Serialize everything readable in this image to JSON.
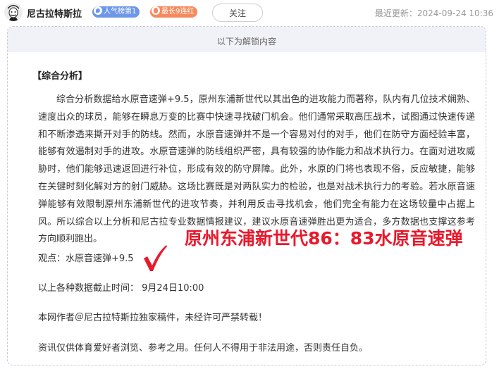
{
  "header": {
    "author_name": "尼古拉特斯拉",
    "badge_popularity": "人气榜第1",
    "badge_streak": "最长9连红",
    "follow_label": "关注",
    "update_label": "最近更新：",
    "update_time": "2024-09-24 10:36"
  },
  "content": {
    "unlock_notice": "以下为解锁内容",
    "section_title": "【综合分析】",
    "paragraph": "综合分析数据给水原音速弹+9.5，原州东浦新世代以其出色的进攻能力而著称，队内有几位技术娴熟、速度出众的球员，能够在瞬息万变的比赛中快速寻找破门机会。他们通常采取高压战术，试图通过快速传递和不断渗透来撕开对手的防线。然而，水原音速弹并不是一个容易对付的对手，他们在防守方面经验丰富，能够有效遏制对手的进攻。水原音速弹的防线组织严密，具有较强的协作能力和战术执行力。在面对进攻威胁时，他们能够迅速返回进行补位，形成有效的防守屏障。此外，水原的门将也表现不俗，反应敏捷，能够在关键时刻化解对方的射门威胁。这场比赛既是对两队实力的检验，也是对战术执行力的考验。若水原音速弹能够有效限制原州东浦新世代的进攻节奏，并利用反击寻找机会，他们完全有能力在这场较量中占据上风。所以综合以上分析和尼古拉专业数据情报建议，建议水原音速弹胜出更为适合，多方数据也支撑这参考方向顺利跑出。",
    "opinion": "观点：水原音速弹+9.5",
    "deadline": "以上各种数据截止时间： 9月24日10:00",
    "copyright": "本网作者＠尼古拉特斯拉独家稿件，未经许可严禁转载！",
    "disclaimer": "资讯仅供体育爱好者浏览、参考之用。任何人不得用于非法用途，否则责任自负。",
    "result_overlay": "原州东浦新世代86：83水原音速弹"
  },
  "colors": {
    "badge_popularity": "#6d97e8",
    "badge_streak": "#f58a5e",
    "overlay_red": "#e8192c",
    "unlock_bar_bg": "#f1f1f8"
  },
  "icons": {
    "avatar": "cartoon-portrait-avatar",
    "badge_popularity": "popularity-icon",
    "badge_streak": "flame-icon",
    "check": "checkmark-icon"
  }
}
